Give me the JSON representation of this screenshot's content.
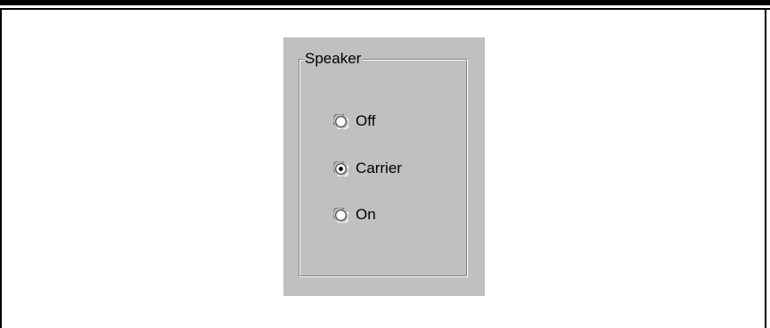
{
  "speaker_group": {
    "title": "Speaker",
    "options": [
      {
        "label": "Off",
        "selected": false
      },
      {
        "label": "Carrier",
        "selected": true
      },
      {
        "label": "On",
        "selected": false
      }
    ]
  },
  "colors": {
    "dialog_face": "#c0c0c0",
    "shadow": "#808080",
    "highlight": "#ffffff"
  }
}
